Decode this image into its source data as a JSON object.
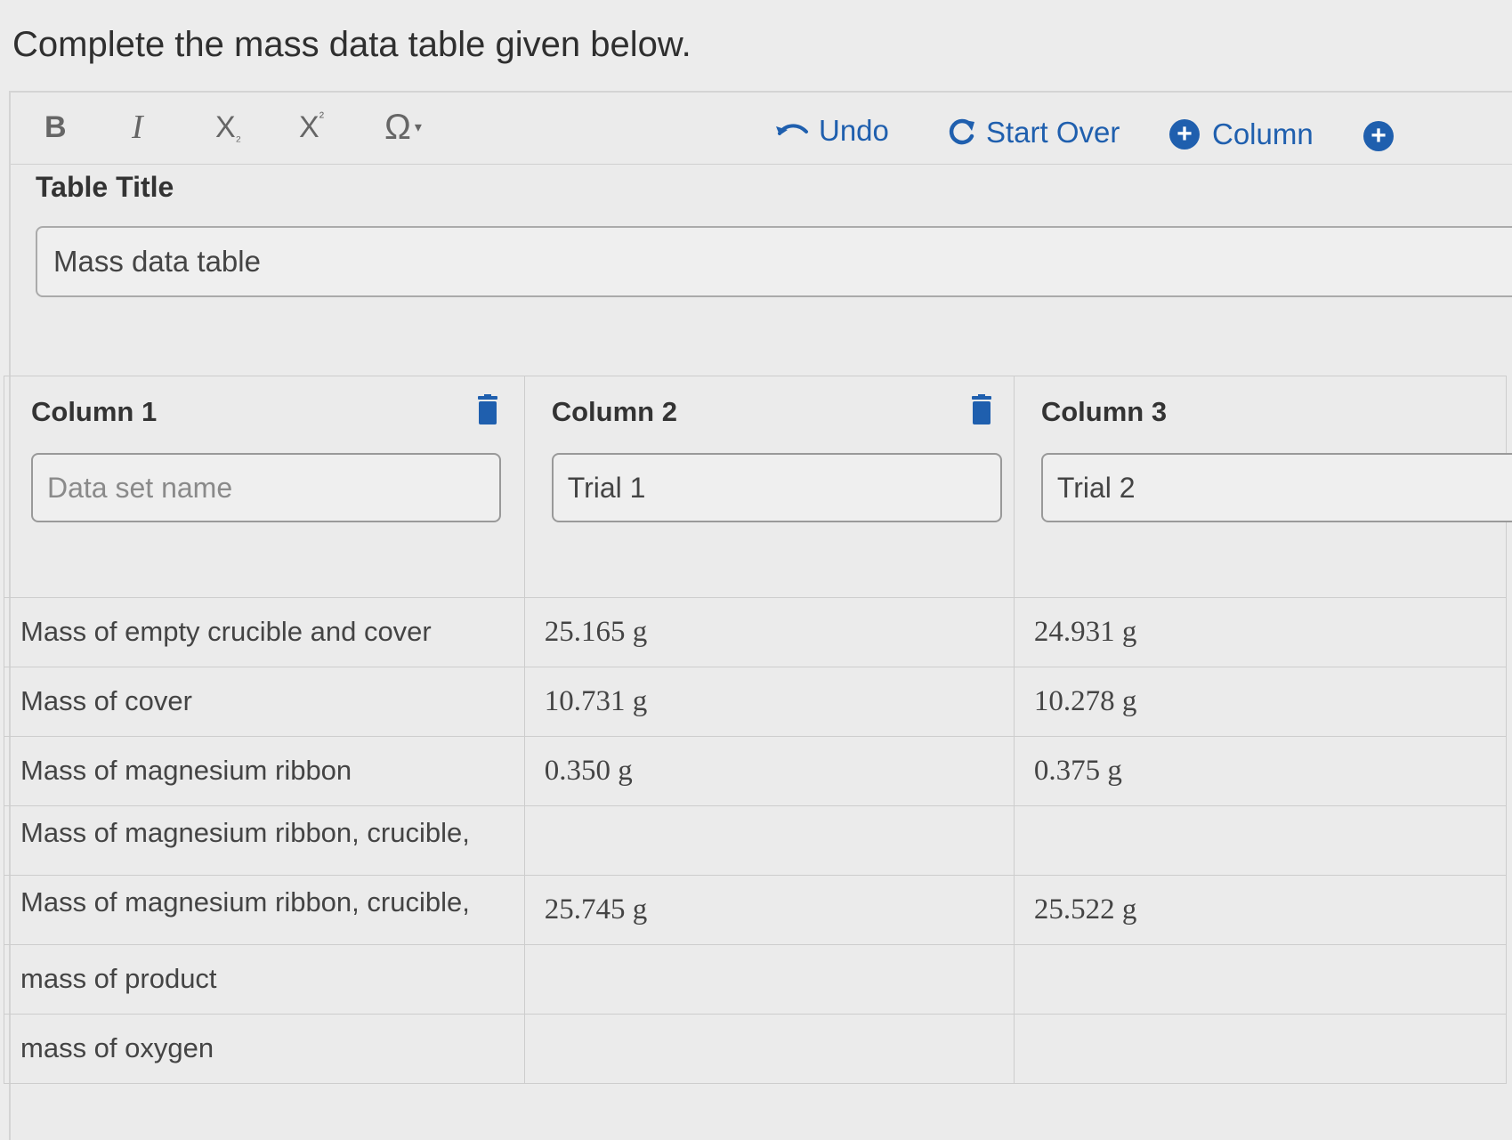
{
  "prompt": "Complete the mass data table given below.",
  "toolbar": {
    "bold": "B",
    "italic": "I",
    "subscript": "X",
    "subscript_mark": "₂",
    "superscript": "X",
    "superscript_mark": "²",
    "special_chars": "Ω",
    "undo": "Undo",
    "start_over": "Start Over",
    "add_column": "Column",
    "add_row_icon": "+"
  },
  "table_title": {
    "label": "Table Title",
    "value": "Mass data table"
  },
  "columns": [
    {
      "name": "Column 1",
      "placeholder": "Data set name",
      "value": ""
    },
    {
      "name": "Column 2",
      "value": "Trial 1"
    },
    {
      "name": "Column 3",
      "value": "Trial 2"
    }
  ],
  "rows": [
    {
      "label": "Mass of empty crucible and cover",
      "trial1": "25.165 g",
      "trial2": "24.931 g"
    },
    {
      "label": "Mass of  cover",
      "trial1": "10.731 g",
      "trial2": "10.278 g"
    },
    {
      "label": "Mass of magnesium ribbon",
      "trial1": "0.350 g",
      "trial2": "0.375 g"
    },
    {
      "label": "Mass of magnesium ribbon, crucible,",
      "trial1": "",
      "trial2": ""
    },
    {
      "label": "Mass of magnesium ribbon, crucible,",
      "trial1": "25.745 g",
      "trial2": "25.522 g"
    },
    {
      "label": "mass of product",
      "trial1": "",
      "trial2": ""
    },
    {
      "label": "mass of oxygen",
      "trial1": "",
      "trial2": ""
    }
  ],
  "colors": {
    "accent": "#1f5fae",
    "background": "#ececec",
    "border": "#cdcdcd"
  }
}
